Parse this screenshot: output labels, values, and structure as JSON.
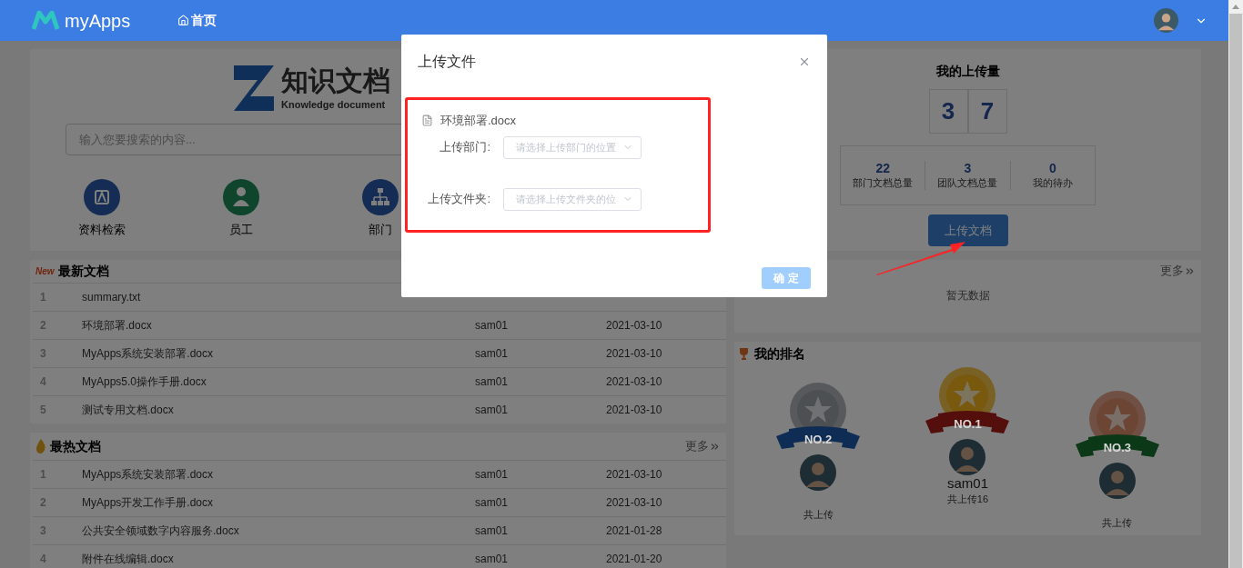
{
  "header": {
    "logo": "myApps",
    "nav": [
      {
        "label": "首页"
      }
    ]
  },
  "search_card": {
    "logo_title": "知识文档",
    "logo_subtitle": "Knowledge document",
    "search_placeholder": "输入您要搜索的内容...",
    "shortcuts": [
      {
        "label": "资料检索",
        "kind": "search"
      },
      {
        "label": "员工",
        "kind": "staff"
      },
      {
        "label": "部门",
        "kind": "org"
      }
    ]
  },
  "upload_stats": {
    "title": "我的上传量",
    "digits": [
      "3",
      "7"
    ],
    "stats": [
      {
        "value": "22",
        "label": "部门文档总量"
      },
      {
        "value": "3",
        "label": "团队文档总量"
      },
      {
        "value": "0",
        "label": "我的待办"
      }
    ],
    "button": "上传文档"
  },
  "latest_docs": {
    "title": "最新文档",
    "badge": "New",
    "rows": [
      {
        "index": "1",
        "name": "summary.txt"
      },
      {
        "index": "2",
        "name": "环境部署.docx",
        "author": "sam01",
        "date": "2021-03-10"
      },
      {
        "index": "3",
        "name": "MyApps系统安装部署.docx",
        "author": "sam01",
        "date": "2021-03-10"
      },
      {
        "index": "4",
        "name": "MyApps5.0操作手册.docx",
        "author": "sam01",
        "date": "2021-03-10"
      },
      {
        "index": "5",
        "name": "测试专用文档.docx",
        "author": "sam01",
        "date": "2021-03-10"
      }
    ]
  },
  "hot_docs": {
    "title": "最热文档",
    "more": "更多",
    "rows": [
      {
        "index": "1",
        "name": "MyApps系统安装部署.docx",
        "author": "sam01",
        "date": "2021-03-10"
      },
      {
        "index": "2",
        "name": "MyApps开发工作手册.docx",
        "author": "sam01",
        "date": "2021-03-10"
      },
      {
        "index": "3",
        "name": "公共安全领域数字内容服务.docx",
        "author": "sam01",
        "date": "2021-01-28"
      },
      {
        "index": "4",
        "name": "附件在线编辑.docx",
        "author": "sam01",
        "date": "2021-01-20"
      }
    ]
  },
  "list_panel": {
    "more": "更多",
    "empty": "暂无数据"
  },
  "ranking": {
    "title": "我的排名",
    "entries": [
      {
        "rank": "NO.2",
        "kind": "silver",
        "caption": "共上传"
      },
      {
        "rank": "NO.1",
        "kind": "gold",
        "name": "sam01",
        "caption": "共上传16"
      },
      {
        "rank": "NO.3",
        "kind": "bronze",
        "caption": "共上传"
      }
    ]
  },
  "dialog": {
    "title": "上传文件",
    "file_name": "环境部署.docx",
    "fields": [
      {
        "label": "上传部门:",
        "placeholder": "请选择上传部门的位置"
      },
      {
        "label": "上传文件夹:",
        "placeholder": "请选择上传文件夹的位"
      }
    ],
    "confirm": {
      "label": "确 定",
      "disabled": true
    }
  }
}
